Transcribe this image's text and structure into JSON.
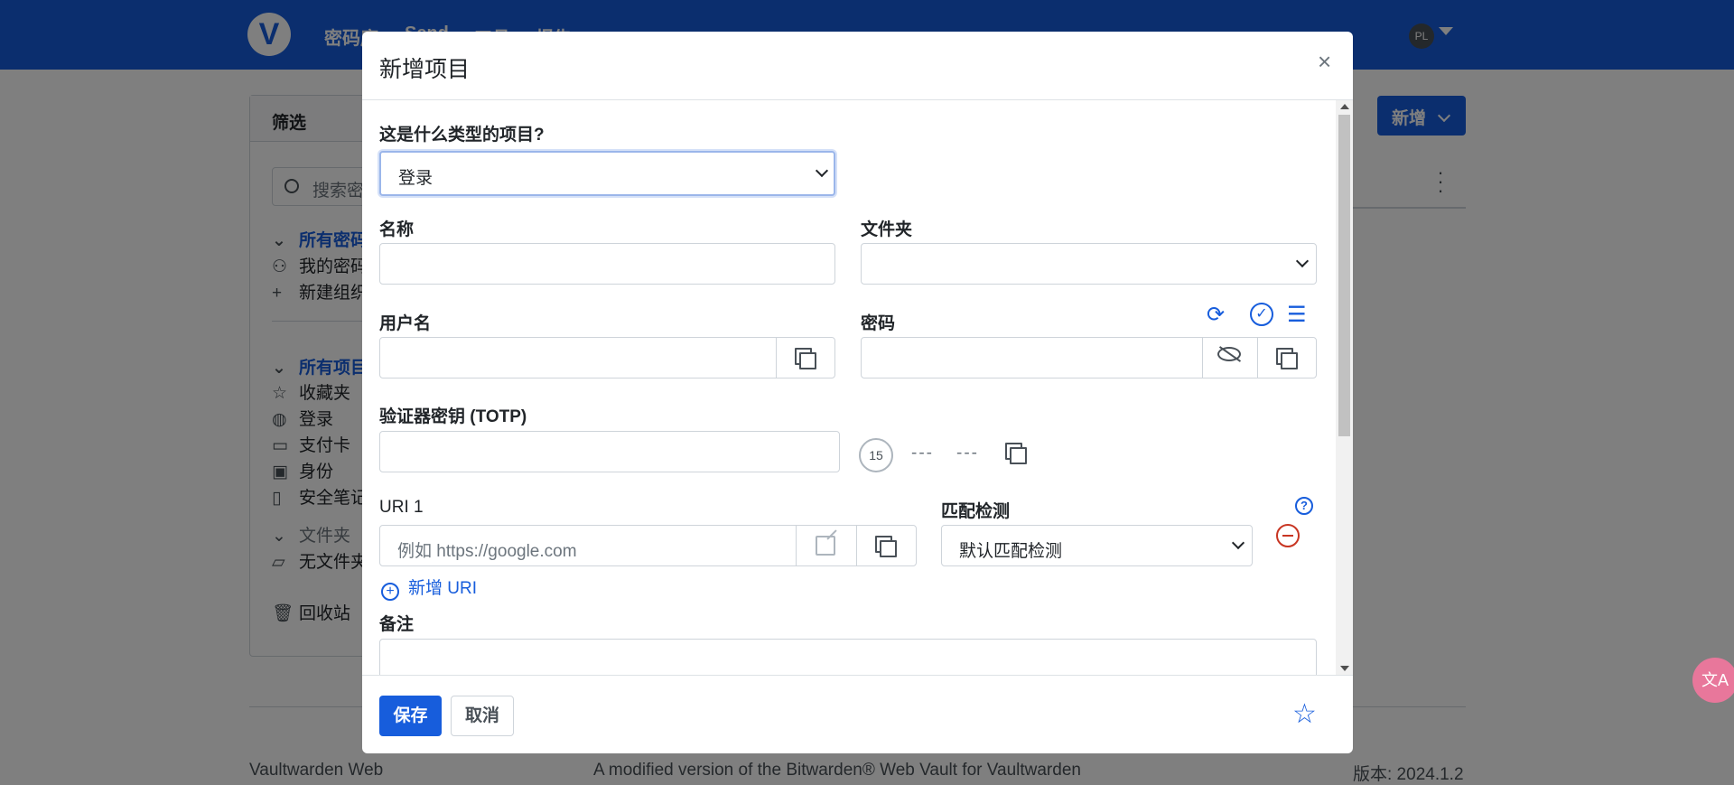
{
  "topnav": {
    "logo": "V",
    "items": [
      "密码库",
      "Send",
      "工具",
      "报告"
    ],
    "avatar_initials": "PL"
  },
  "filter": {
    "title": "筛选",
    "search_placeholder": "搜索密码库",
    "all_vaults": "所有密码库",
    "my_vault": "我的密码库",
    "new_org": "新建组织",
    "all_items": "所有项目",
    "favorites": "收藏夹",
    "login": "登录",
    "card": "支付卡",
    "identity": "身份",
    "secure_note": "安全笔记",
    "folders": "文件夹",
    "no_folder": "无文件夹",
    "trash": "回收站"
  },
  "new_button_label": "新增",
  "footer": {
    "left": "Vaultwarden Web",
    "center": "A modified version of the Bitwarden® Web Vault for Vaultwarden",
    "right": "版本: 2024.1.2"
  },
  "translate_fab": "文A",
  "modal": {
    "title": "新增项目",
    "close": "×",
    "type_label": "这是什么类型的项目?",
    "type_value": "登录",
    "name_label": "名称",
    "name_value": "",
    "folder_label": "文件夹",
    "folder_value": "",
    "username_label": "用户名",
    "username_value": "",
    "password_label": "密码",
    "password_value": "",
    "totp_label": "验证器密钥 (TOTP)",
    "totp_value": "",
    "totp_timer": "15",
    "totp_code_part1": "---",
    "totp_code_part2": "---",
    "uri_label": "URI 1",
    "uri_placeholder": "例如 https://google.com",
    "match_label": "匹配检测",
    "match_value": "默认匹配检测",
    "add_uri": "新增 URI",
    "notes_label": "备注",
    "save": "保存",
    "cancel": "取消"
  },
  "colors": {
    "primary": "#175ddc",
    "danger": "#c83522",
    "border": "#ced4da"
  }
}
